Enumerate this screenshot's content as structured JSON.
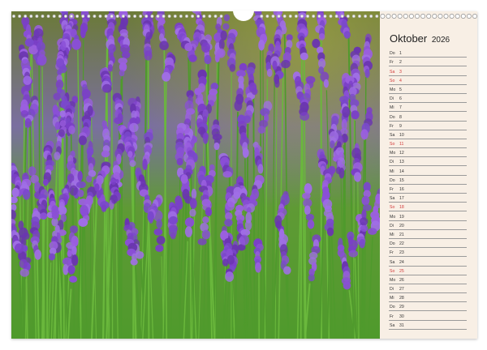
{
  "calendar": {
    "month": "Oktober",
    "year": "2026",
    "days": [
      {
        "wd": "Do",
        "d": "1",
        "weekend": false
      },
      {
        "wd": "Fr",
        "d": "2",
        "weekend": false
      },
      {
        "wd": "Sa",
        "d": "3",
        "weekend": true
      },
      {
        "wd": "So",
        "d": "4",
        "weekend": true
      },
      {
        "wd": "Mo",
        "d": "5",
        "weekend": false
      },
      {
        "wd": "Di",
        "d": "6",
        "weekend": false
      },
      {
        "wd": "Mi",
        "d": "7",
        "weekend": false
      },
      {
        "wd": "Do",
        "d": "8",
        "weekend": false
      },
      {
        "wd": "Fr",
        "d": "9",
        "weekend": false
      },
      {
        "wd": "Sa",
        "d": "10",
        "weekend": false
      },
      {
        "wd": "So",
        "d": "11",
        "weekend": true
      },
      {
        "wd": "Mo",
        "d": "12",
        "weekend": false
      },
      {
        "wd": "Di",
        "d": "13",
        "weekend": false
      },
      {
        "wd": "Mi",
        "d": "14",
        "weekend": false
      },
      {
        "wd": "Do",
        "d": "15",
        "weekend": false
      },
      {
        "wd": "Fr",
        "d": "16",
        "weekend": false
      },
      {
        "wd": "Sa",
        "d": "17",
        "weekend": false
      },
      {
        "wd": "So",
        "d": "18",
        "weekend": true
      },
      {
        "wd": "Mo",
        "d": "19",
        "weekend": false
      },
      {
        "wd": "Di",
        "d": "20",
        "weekend": false
      },
      {
        "wd": "Mi",
        "d": "21",
        "weekend": false
      },
      {
        "wd": "Do",
        "d": "22",
        "weekend": false
      },
      {
        "wd": "Fr",
        "d": "23",
        "weekend": false
      },
      {
        "wd": "Sa",
        "d": "24",
        "weekend": false
      },
      {
        "wd": "So",
        "d": "25",
        "weekend": true
      },
      {
        "wd": "Mo",
        "d": "26",
        "weekend": false
      },
      {
        "wd": "Di",
        "d": "27",
        "weekend": false
      },
      {
        "wd": "Mi",
        "d": "28",
        "weekend": false
      },
      {
        "wd": "Do",
        "d": "29",
        "weekend": false
      },
      {
        "wd": "Fr",
        "d": "30",
        "weekend": false
      },
      {
        "wd": "Sa",
        "d": "31",
        "weekend": false
      }
    ]
  },
  "colors": {
    "panel": "#f8efe5",
    "weekend": "#d23a3a",
    "lavender": "#8a4fd6",
    "grass": "#5fa83a"
  },
  "photo": {
    "subject": "lavender-field"
  }
}
